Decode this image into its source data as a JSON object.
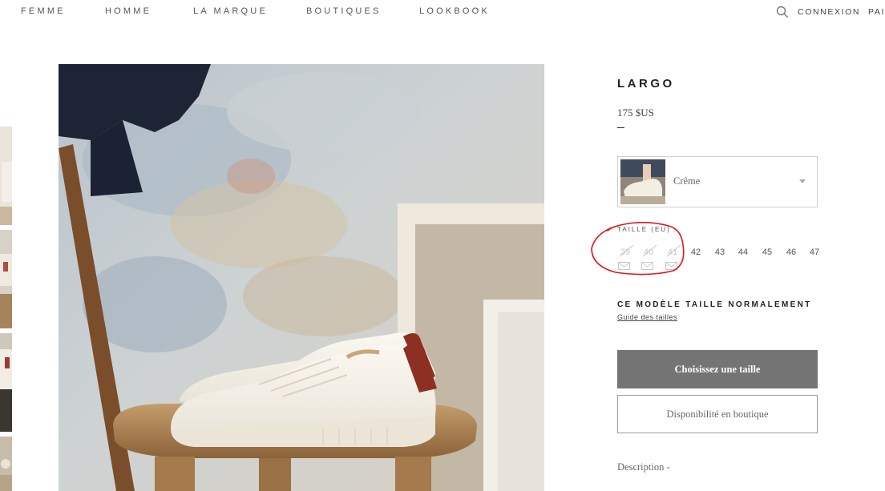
{
  "nav": {
    "items": [
      "FEMME",
      "HOMME",
      "LA MARQUE",
      "BOUTIQUES",
      "LOOKBOOK"
    ],
    "connexion": "CONNEXION",
    "cart_partial": "PAI"
  },
  "product": {
    "title": "LARGO",
    "price": "175 $US",
    "color_value": "Crême",
    "size_label": "TAILLE (EU) :",
    "sizes": [
      {
        "label": "39",
        "available": false
      },
      {
        "label": "40",
        "available": false
      },
      {
        "label": "41",
        "available": false
      },
      {
        "label": "42",
        "available": true
      },
      {
        "label": "43",
        "available": true
      },
      {
        "label": "44",
        "available": true
      },
      {
        "label": "45",
        "available": true
      },
      {
        "label": "46",
        "available": true
      },
      {
        "label": "47",
        "available": true
      }
    ],
    "fit_note": "CE MODÈLE TAILLE NORMALEMENT",
    "size_guide": "Guide des tailles",
    "primary_button": "Choisissez une taille",
    "secondary_button": "Disponibilité en boutique",
    "description_label": "Description -"
  },
  "colors": {
    "primary_button_bg": "#747474",
    "annotation": "#e0161b"
  }
}
